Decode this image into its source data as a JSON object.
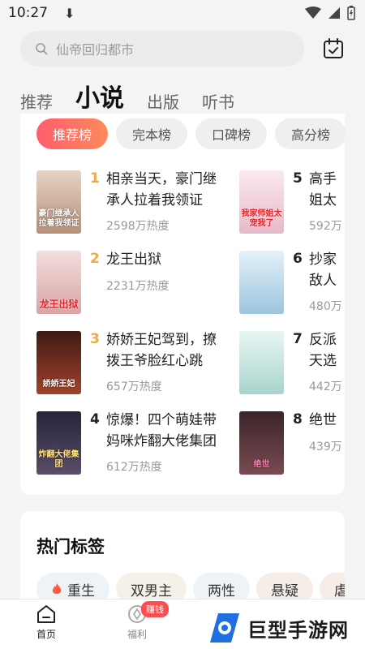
{
  "status_bar": {
    "time": "10:27",
    "download_glyph": "⬇",
    "icons": [
      "wifi-icon",
      "signal-icon",
      "battery-icon"
    ]
  },
  "search": {
    "placeholder": "仙帝回归都市"
  },
  "top_tabs": [
    {
      "label": "推荐",
      "active": false
    },
    {
      "label": "小说",
      "active": true
    },
    {
      "label": "出版",
      "active": false
    },
    {
      "label": "听书",
      "active": false
    }
  ],
  "ranking_chips": [
    {
      "label": "推荐榜",
      "active": true
    },
    {
      "label": "完本榜",
      "active": false
    },
    {
      "label": "口碑榜",
      "active": false
    },
    {
      "label": "高分榜",
      "active": false
    }
  ],
  "books": [
    {
      "rank": "1",
      "title": "相亲当天，豪门继承人拉着我领证",
      "heat": "2598万热度",
      "cover_text": "豪门继承人拉着我领证",
      "cover_color": "#c9a58f"
    },
    {
      "rank": "2",
      "title": "龙王出狱",
      "heat": "2231万热度",
      "cover_text": "龙王出狱",
      "cover_color": "#e8c4c4"
    },
    {
      "rank": "3",
      "title": "娇娇王妃驾到，撩拨王爷脸红心跳",
      "heat": "657万热度",
      "cover_text": "娇娇王妃",
      "cover_color": "#7a2a1d"
    },
    {
      "rank": "4",
      "title": "惊爆！四个萌娃带妈咪炸翻大佬集团",
      "heat": "612万热度",
      "cover_text": "炸翻大佬集团",
      "cover_color": "#3c3a52"
    },
    {
      "rank": "5",
      "title": "高手",
      "title_tail": "姐太",
      "heat": "592万",
      "cover_text": "我家师姐太宠我了",
      "cover_color": "#f2d3dc"
    },
    {
      "rank": "6",
      "title": "抄家",
      "title_tail": "敌人",
      "heat": "480万",
      "cover_text": "",
      "cover_color": "#b9d7ea"
    },
    {
      "rank": "7",
      "title": "反派",
      "title_tail": "天选",
      "heat": "442万",
      "cover_text": "",
      "cover_color": "#cbe7e2"
    },
    {
      "rank": "8",
      "title": "绝世",
      "heat": "439万",
      "cover_text": "绝世",
      "cover_color": "#5a3a3f"
    }
  ],
  "hot_tags": {
    "title": "热门标签",
    "items": [
      {
        "label": "重生",
        "icon": "flame-icon",
        "bg": "#eef3f7"
      },
      {
        "label": "双男主",
        "bg": "#f6f1e8"
      },
      {
        "label": "两性",
        "bg": "#eef3f7"
      },
      {
        "label": "悬疑",
        "bg": "#f6ece8"
      },
      {
        "label": "虐",
        "bg": "#f6ece8"
      }
    ]
  },
  "bottom_nav": {
    "items": [
      {
        "label": "首页",
        "icon": "home-icon",
        "active": true
      },
      {
        "label": "福利",
        "icon": "welfare-icon",
        "active": false
      }
    ],
    "earn_badge": "赚钱"
  },
  "watermark": {
    "text": "巨型手游网"
  },
  "colors": {
    "accent_gradient_start": "#ff5d6e",
    "accent_gradient_end": "#ff8a5c",
    "rank_top": "#f0a94a",
    "badge": "#ff4d4f"
  }
}
